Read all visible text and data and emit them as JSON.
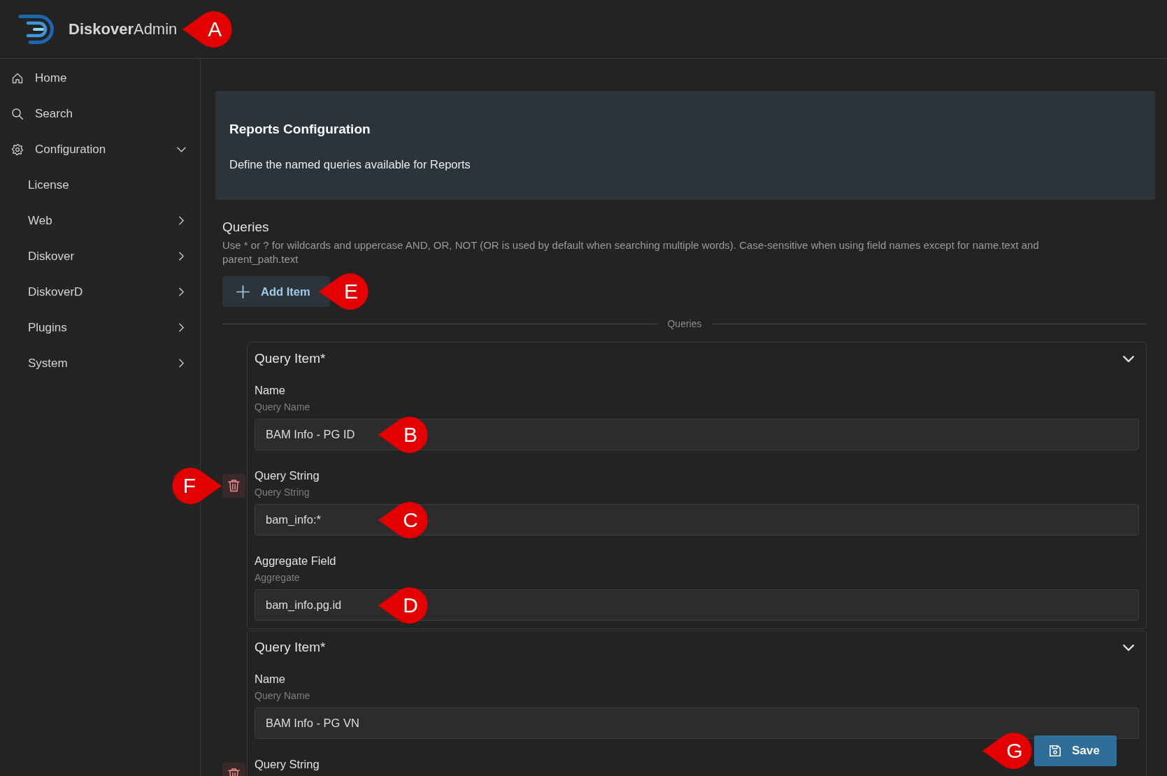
{
  "header": {
    "brand": "**Diskover**Admin",
    "callout": "A"
  },
  "sidebar": {
    "items": [
      {
        "label": "Home",
        "kind": "link"
      },
      {
        "label": "Search",
        "kind": "link"
      },
      {
        "label": "Configuration",
        "kind": "group",
        "expanded": true,
        "children": [
          {
            "label": "License",
            "kind": "link"
          },
          {
            "label": "Web",
            "kind": "group",
            "expanded": false
          },
          {
            "label": "Diskover",
            "kind": "group",
            "expanded": false
          },
          {
            "label": "DiskoverD",
            "kind": "group",
            "expanded": false
          },
          {
            "label": "Plugins",
            "kind": "group",
            "expanded": false
          },
          {
            "label": "System",
            "kind": "group",
            "expanded": false
          }
        ]
      }
    ]
  },
  "page_header": {
    "title": "Reports Configuration",
    "description": "Define the named queries available for Reports"
  },
  "queries": {
    "title": "Queries",
    "help": "Use * or ? for wildcards and uppercase AND, OR, NOT (OR is used by default when searching multiple words). Case-sensitive when using field names except for name.text and parent_path.text",
    "add_button": {
      "label": "Add Item",
      "callout": "E"
    },
    "divider_label": "Queries",
    "items": [
      {
        "title": "Query Item*",
        "expanded": true,
        "delete_callout": "F",
        "fields": [
          {
            "label": "Name",
            "hint": "Query Name",
            "value": "BAM Info - PG ID",
            "callout": "B"
          },
          {
            "label": "Query String",
            "hint": "Query String",
            "value": "bam_info:*",
            "callout": "C"
          },
          {
            "label": "Aggregate Field",
            "hint": "Aggregate",
            "value": "bam_info.pg.id",
            "callout": "D"
          }
        ]
      },
      {
        "title": "Query Item*",
        "expanded": true,
        "fields": [
          {
            "label": "Name",
            "hint": "Query Name",
            "value": "BAM Info - PG VN"
          },
          {
            "label": "Query String"
          }
        ]
      }
    ]
  },
  "save_button": {
    "label": "Save",
    "callout": "G"
  }
}
